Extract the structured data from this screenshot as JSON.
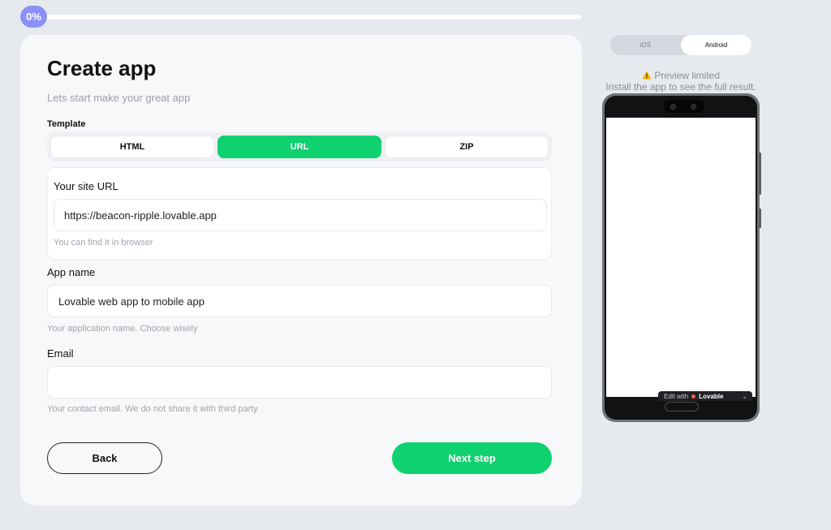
{
  "progress": {
    "label": "0%",
    "value": 0
  },
  "form": {
    "title": "Create app",
    "subtitle": "Lets start make your great app",
    "template_label": "Template",
    "template_options": [
      "HTML",
      "URL",
      "ZIP"
    ],
    "template_selected": "URL",
    "site_url": {
      "label": "Your site URL",
      "value": "https://beacon-ripple.lovable.app",
      "hint": "You can find it in browser"
    },
    "app_name": {
      "label": "App name",
      "value": "Lovable web app to mobile app",
      "hint": "Your application name. Choose wisely"
    },
    "email": {
      "label": "Email",
      "value": "",
      "hint": "Your contact email. We do not share it with third party"
    },
    "back_label": "Back",
    "next_label": "Next step"
  },
  "preview": {
    "os_options": [
      "iOS",
      "Android"
    ],
    "os_selected": "Android",
    "warning_icon": "warning-icon",
    "warning_title": "Preview limited",
    "warning_text": "Install the app to see the full result.",
    "edit_bar_prefix": "Edit with",
    "edit_bar_brand": "Lovable"
  },
  "colors": {
    "accent_green": "#0fd16f",
    "progress_purple": "#8b90f7",
    "background": "#e6e9ee"
  }
}
